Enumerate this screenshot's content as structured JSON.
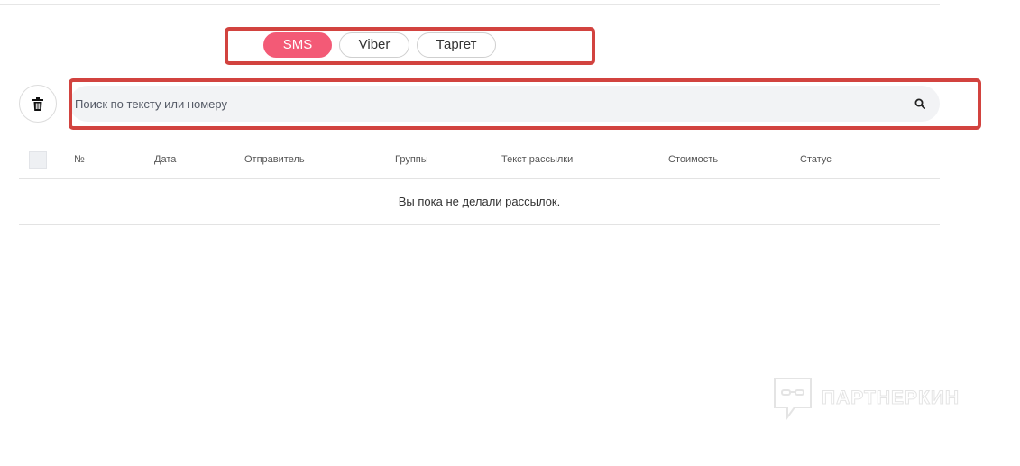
{
  "tabs": [
    {
      "label": "SMS",
      "active": true
    },
    {
      "label": "Viber",
      "active": false
    },
    {
      "label": "Таргет",
      "active": false
    }
  ],
  "toolbar": {
    "delete_icon": "trash-icon"
  },
  "search": {
    "placeholder": "Поиск по тексту или номеру",
    "value": "",
    "icon": "search-icon"
  },
  "table": {
    "columns": [
      "№",
      "Дата",
      "Отправитель",
      "Группы",
      "Текст рассылки",
      "Стоимость",
      "Статус"
    ],
    "empty_message": "Вы пока не делали рассылок."
  },
  "watermark": {
    "text": "ПАРТНЕРКИН"
  },
  "colors": {
    "accent": "#f35a76",
    "highlight_frame": "#d2433f"
  }
}
